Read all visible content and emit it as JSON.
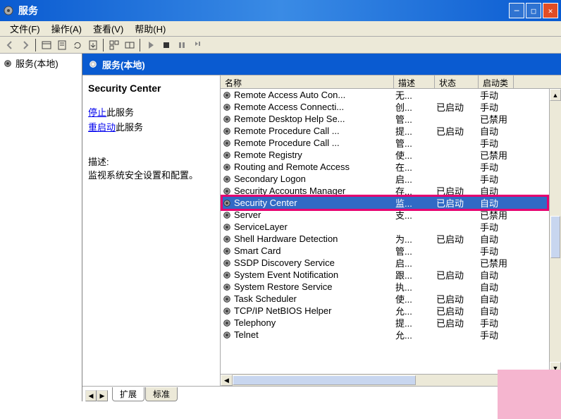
{
  "window": {
    "title": "服务"
  },
  "menu": {
    "file": "文件(F)",
    "action": "操作(A)",
    "view": "查看(V)",
    "help": "帮助(H)"
  },
  "leftTree": {
    "root": "服务(本地)"
  },
  "rightTitle": "服务(本地)",
  "detail": {
    "name": "Security Center",
    "stopLink": "停止",
    "stopSuffix": "此服务",
    "restartLink": "重启动",
    "restartSuffix": "此服务",
    "descLabel": "描述:",
    "descText": "监视系统安全设置和配置。"
  },
  "columns": {
    "name": "名称",
    "desc": "描述",
    "status": "状态",
    "start": "启动类"
  },
  "tabs": {
    "extended": "扩展",
    "standard": "标准"
  },
  "services": [
    {
      "name": "Remote Access Auto Con...",
      "desc": "无...",
      "status": "",
      "start": "手动"
    },
    {
      "name": "Remote Access Connecti...",
      "desc": "创...",
      "status": "已启动",
      "start": "手动"
    },
    {
      "name": "Remote Desktop Help Se...",
      "desc": "管...",
      "status": "",
      "start": "已禁用"
    },
    {
      "name": "Remote Procedure Call ...",
      "desc": "提...",
      "status": "已启动",
      "start": "自动"
    },
    {
      "name": "Remote Procedure Call ...",
      "desc": "管...",
      "status": "",
      "start": "手动"
    },
    {
      "name": "Remote Registry",
      "desc": "使...",
      "status": "",
      "start": "已禁用"
    },
    {
      "name": "Routing and Remote Access",
      "desc": "在...",
      "status": "",
      "start": "手动"
    },
    {
      "name": "Secondary Logon",
      "desc": "启...",
      "status": "",
      "start": "手动"
    },
    {
      "name": "Security Accounts Manager",
      "desc": "存...",
      "status": "已启动",
      "start": "自动"
    },
    {
      "name": "Security Center",
      "desc": "监...",
      "status": "已启动",
      "start": "自动",
      "selected": true
    },
    {
      "name": "Server",
      "desc": "支...",
      "status": "",
      "start": "已禁用"
    },
    {
      "name": "ServiceLayer",
      "desc": "",
      "status": "",
      "start": "手动"
    },
    {
      "name": "Shell Hardware Detection",
      "desc": "为...",
      "status": "已启动",
      "start": "自动"
    },
    {
      "name": "Smart Card",
      "desc": "管...",
      "status": "",
      "start": "手动"
    },
    {
      "name": "SSDP Discovery Service",
      "desc": "启...",
      "status": "",
      "start": "已禁用"
    },
    {
      "name": "System Event Notification",
      "desc": "跟...",
      "status": "已启动",
      "start": "自动"
    },
    {
      "name": "System Restore Service",
      "desc": "执...",
      "status": "",
      "start": "自动"
    },
    {
      "name": "Task Scheduler",
      "desc": "使...",
      "status": "已启动",
      "start": "自动"
    },
    {
      "name": "TCP/IP NetBIOS Helper",
      "desc": "允...",
      "status": "已启动",
      "start": "自动"
    },
    {
      "name": "Telephony",
      "desc": "提...",
      "status": "已启动",
      "start": "手动"
    },
    {
      "name": "Telnet",
      "desc": "允...",
      "status": "",
      "start": "手动"
    }
  ]
}
